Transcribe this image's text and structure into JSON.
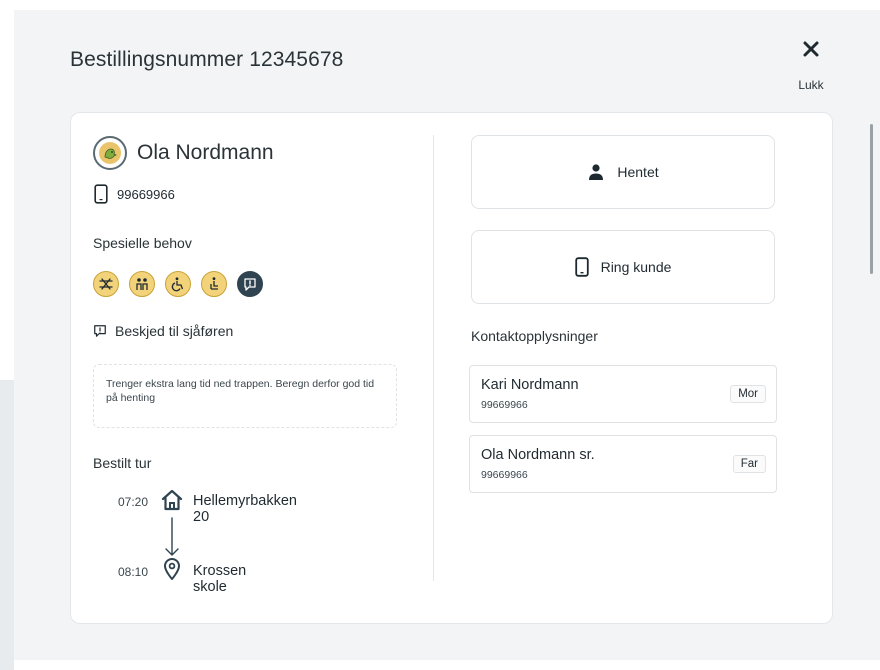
{
  "modal": {
    "title": "Bestillingsnummer 12345678",
    "close_label": "Lukk"
  },
  "customer": {
    "name": "Ola Nordmann",
    "phone": "99669966"
  },
  "special_needs": {
    "label": "Spesielle behov",
    "icons": [
      "allergy-icon",
      "companion-icon",
      "wheelchair-icon",
      "wheelchair-assist-icon",
      "message-icon"
    ]
  },
  "driver_message": {
    "label": "Beskjed til sjåføren",
    "text": "Trenger ekstra lang tid ned trappen. Beregn derfor god tid på henting"
  },
  "trip": {
    "label": "Bestilt tur",
    "from": {
      "time": "07:20",
      "address": "Hellemyrbakken 20"
    },
    "to": {
      "time": "08:10",
      "address": "Krossen skole"
    }
  },
  "actions": {
    "picked_up_label": "Hentet",
    "call_label": "Ring kunde"
  },
  "contacts": {
    "label": "Kontaktopplysninger",
    "items": [
      {
        "name": "Kari Nordmann",
        "phone": "99669966",
        "relation": "Mor"
      },
      {
        "name": "Ola Nordmann sr.",
        "phone": "99669966",
        "relation": "Far"
      }
    ]
  },
  "colors": {
    "need_yellow": "#f3d37a",
    "need_dark": "#2f4450",
    "text": "#1f2a30"
  }
}
